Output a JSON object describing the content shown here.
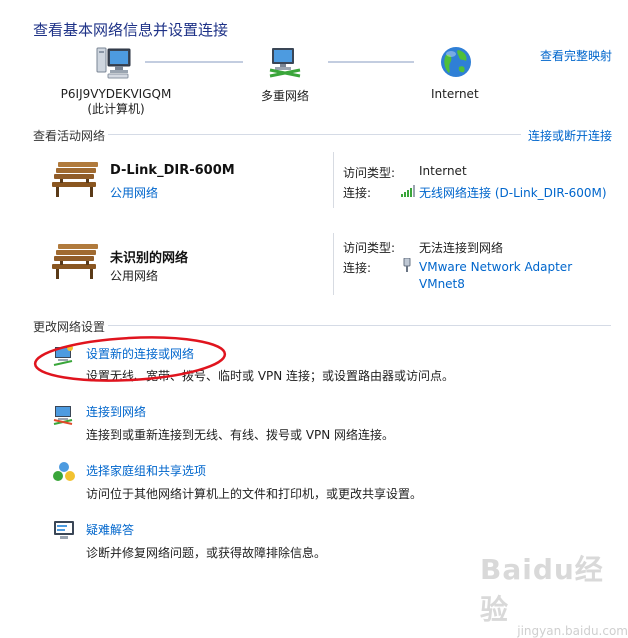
{
  "header": {
    "title": "查看基本网络信息并设置连接",
    "view_full_map": "查看完整映射"
  },
  "network_map": {
    "computer_name": "P6IJ9VYDEKVIGQM",
    "computer_sub": "(此计算机)",
    "middle_label": "多重网络",
    "internet_label": "Internet"
  },
  "active_networks": {
    "heading": "查看活动网络",
    "connect_link": "连接或断开连接",
    "items": [
      {
        "name": "D-Link_DIR-600M",
        "type_link": "公用网络",
        "access_label": "访问类型:",
        "access_value": "Internet",
        "conn_label": "连接:",
        "conn_value": "无线网络连接 (D-Link_DIR-600M)"
      },
      {
        "name": "未识别的网络",
        "type_text": "公用网络",
        "access_label": "访问类型:",
        "access_value": "无法连接到网络",
        "conn_label": "连接:",
        "conn_value_line1": "VMware Network Adapter",
        "conn_value_line2": "VMnet8"
      }
    ]
  },
  "change_settings": {
    "heading": "更改网络设置",
    "tasks": [
      {
        "title": "设置新的连接或网络",
        "desc": "设置无线、宽带、拨号、临时或 VPN 连接；或设置路由器或访问点。",
        "icon": "new-connection-icon"
      },
      {
        "title": "连接到网络",
        "desc": "连接到或重新连接到无线、有线、拨号或 VPN 网络连接。",
        "icon": "connect-network-icon"
      },
      {
        "title": "选择家庭组和共享选项",
        "desc": "访问位于其他网络计算机上的文件和打印机，或更改共享设置。",
        "icon": "homegroup-icon"
      },
      {
        "title": "疑难解答",
        "desc": "诊断并修复网络问题，或获得故障排除信息。",
        "icon": "troubleshoot-icon"
      }
    ]
  },
  "colors": {
    "link": "#0066cc",
    "title": "#1e3287",
    "annotation_ellipse": "#e0141e"
  },
  "watermark": {
    "text": "Baidu经验",
    "sub": "jingyan.baidu.com"
  }
}
